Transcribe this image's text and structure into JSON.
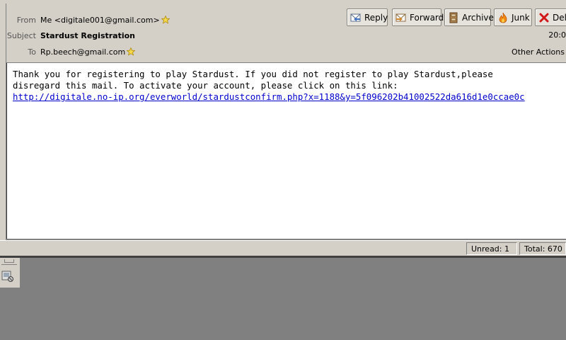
{
  "header": {
    "from_label": "From",
    "from_value": "Me <digitale001@gmail.com>",
    "subject_label": "Subject",
    "subject_value": "Stardust Registration",
    "to_label": "To",
    "to_value": "Rp.beech@gmail.com",
    "time": "20:0",
    "other_actions": "Other Actions"
  },
  "toolbar": {
    "reply_label": "Reply",
    "forward_label": "Forward",
    "archive_label": "Archive",
    "junk_label": "Junk",
    "delete_label": "Dele"
  },
  "message": {
    "line1": "Thank you for registering to play Stardust. If you did not register to play Stardust,please",
    "line2": "disregard this mail. To activate your account, please click on this link:",
    "link": "http://digitale.no-ip.org/everworld/stardustconfirm.php?x=1188&y=5f096202b41002522da616d1e0ccae0c"
  },
  "status": {
    "unread": "Unread: 1",
    "total": "Total: 670"
  },
  "colors": {
    "chrome": "#d4d0c8",
    "link": "#0000cc",
    "desktop": "#808080"
  }
}
